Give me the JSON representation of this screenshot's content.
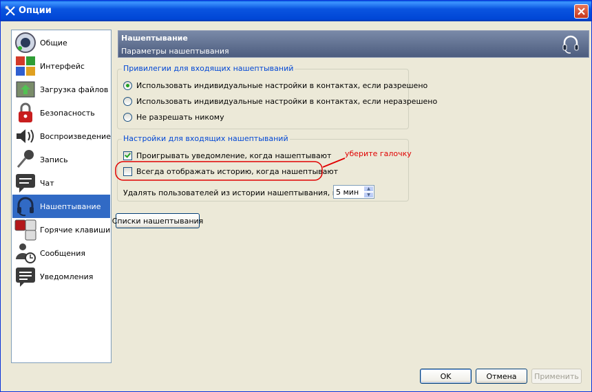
{
  "window": {
    "title": "Опции",
    "close_icon": "close-icon"
  },
  "sidebar": {
    "items": [
      {
        "label": "Общие",
        "icon": "speaker-icon"
      },
      {
        "label": "Интерфейс",
        "icon": "palette-icon"
      },
      {
        "label": "Загрузка файлов",
        "icon": "file-transfer-icon"
      },
      {
        "label": "Безопасность",
        "icon": "lock-icon"
      },
      {
        "label": "Воспроизведение",
        "icon": "volume-icon"
      },
      {
        "label": "Запись",
        "icon": "microphone-icon"
      },
      {
        "label": "Чат",
        "icon": "chat-icon"
      },
      {
        "label": "Нашептывание",
        "icon": "headset-icon",
        "selected": true
      },
      {
        "label": "Горячие клавиши",
        "icon": "hotkeys-icon"
      },
      {
        "label": "Сообщения",
        "icon": "messages-icon"
      },
      {
        "label": "Уведомления",
        "icon": "notifications-icon"
      }
    ]
  },
  "header": {
    "title": "Нашептывание",
    "subtitle": "Параметры нашептывания",
    "icon": "headset-icon"
  },
  "privileges": {
    "title": "Привилегии для входящих нашептываний",
    "options": [
      {
        "label": "Использовать индивидуальные настройки в контактах, если разрешено",
        "checked": true
      },
      {
        "label": "Использовать индивидуальные настройки в контактах, если неразрешено",
        "checked": false
      },
      {
        "label": "Не разрешать никому",
        "checked": false
      }
    ]
  },
  "settings": {
    "title": "Настройки для входящих нашептываний",
    "play_notification": {
      "label": "Проигрывать уведомление, когда нашептывают",
      "checked": true
    },
    "show_history": {
      "label": "Всегда отображать историю, когда нашептывают",
      "checked": false
    },
    "delete_label": "Удалять пользователей из истории нашептывания, после",
    "delete_value": "5 мин"
  },
  "annotation": {
    "text": "уберите галочку",
    "color": "#e00000"
  },
  "whisper_lists_button": "Списки нашептывания",
  "footer": {
    "ok": "OK",
    "cancel": "Отмена",
    "apply": "Применить"
  },
  "colors": {
    "titlebar": "#0a55e0",
    "selection": "#316ac5",
    "group_title": "#0046d5"
  }
}
